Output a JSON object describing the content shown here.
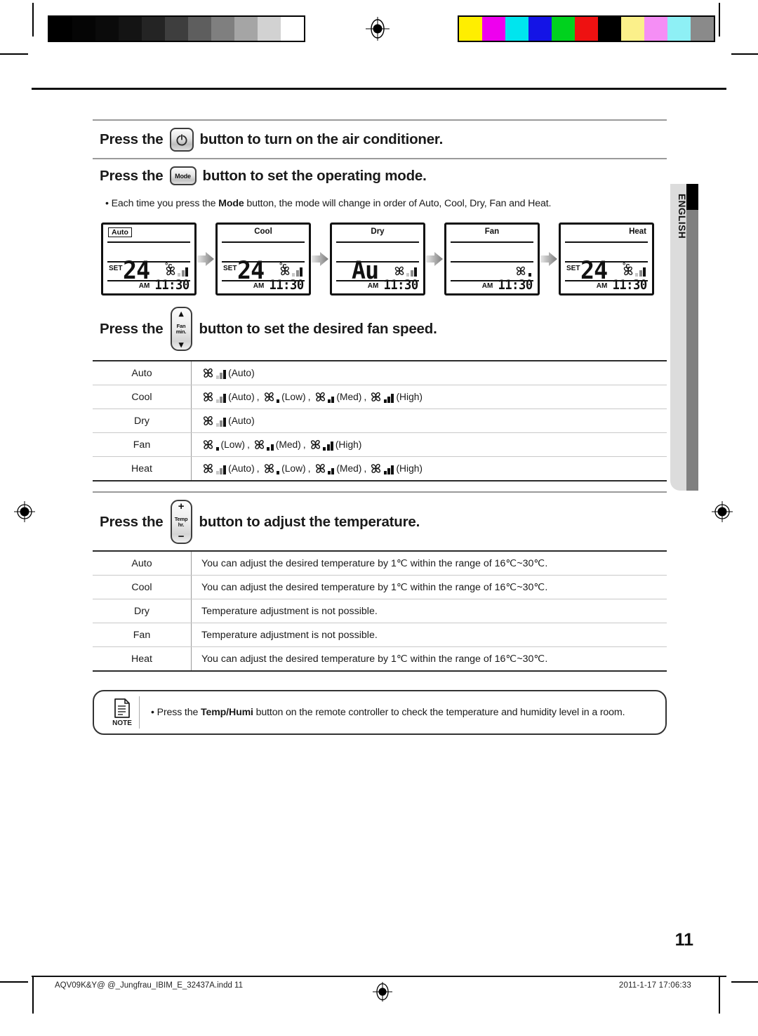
{
  "calibration": {
    "gray_ramp": [
      "#000000",
      "#050505",
      "#0b0b0b",
      "#141414",
      "#242424",
      "#3e3e3e",
      "#5e5e5e",
      "#7f7f7f",
      "#a5a5a5",
      "#d2d2d2",
      "#ffffff"
    ],
    "color_bars": [
      "#ffee00",
      "#ee00ee",
      "#00e5ee",
      "#1414e6",
      "#00d21e",
      "#ee1111",
      "#000000",
      "#fbf08a",
      "#f58ef5",
      "#8ef0f5",
      "#8a8a8a"
    ]
  },
  "sections": {
    "power": {
      "prefix": "Press the",
      "button_icon": "power-icon",
      "suffix": "button to turn on the air conditioner."
    },
    "mode": {
      "prefix": "Press the",
      "button_label": "Mode",
      "suffix": "button to set the operating mode.",
      "bullet_pre": "Each time you press the ",
      "bullet_bold": "Mode",
      "bullet_post": " button, the mode will change in order of Auto, Cool, Dry, Fan and Heat."
    },
    "fan": {
      "prefix": "Press the",
      "button_top": "Fan",
      "button_bottom": "min.",
      "suffix": "button to set the desired fan speed."
    },
    "temp": {
      "prefix": "Press the",
      "button_plus": "+",
      "button_top": "Temp",
      "button_bottom": "hr.",
      "button_minus": "−",
      "suffix": "button to adjust the temperature."
    }
  },
  "lcd_panels": [
    {
      "mode": "Auto",
      "label_style": "boxed",
      "set": "SET",
      "temp": "24",
      "unit": "°c",
      "fan": "auto",
      "am": "AM",
      "time": "11:30",
      "show_temp": true
    },
    {
      "mode": "Cool",
      "label_style": "center",
      "set": "SET",
      "temp": "24",
      "unit": "°c",
      "fan": "auto",
      "am": "AM",
      "time": "11:30",
      "show_temp": true
    },
    {
      "mode": "Dry",
      "label_style": "center",
      "set": "",
      "temp": "Au",
      "unit": "",
      "fan": "auto",
      "am": "AM",
      "time": "11:30",
      "show_temp": true
    },
    {
      "mode": "Fan",
      "label_style": "center",
      "set": "",
      "temp": "",
      "unit": "",
      "fan": "low",
      "am": "AM",
      "time": "11:30",
      "show_temp": false
    },
    {
      "mode": "Heat",
      "label_style": "right",
      "set": "SET",
      "temp": "24",
      "unit": "°c",
      "fan": "auto",
      "am": "AM",
      "time": "11:30",
      "show_temp": true
    }
  ],
  "fan_table": {
    "rows": [
      {
        "mode": "Auto",
        "speeds": [
          {
            "icon": "auto",
            "label": "(Auto)"
          }
        ]
      },
      {
        "mode": "Cool",
        "speeds": [
          {
            "icon": "auto",
            "label": "(Auto)"
          },
          {
            "icon": "low",
            "label": "(Low)"
          },
          {
            "icon": "med",
            "label": "(Med)"
          },
          {
            "icon": "high",
            "label": "(High)"
          }
        ]
      },
      {
        "mode": "Dry",
        "speeds": [
          {
            "icon": "auto",
            "label": "(Auto)"
          }
        ]
      },
      {
        "mode": "Fan",
        "speeds": [
          {
            "icon": "low",
            "label": "(Low)"
          },
          {
            "icon": "med",
            "label": "(Med)"
          },
          {
            "icon": "high",
            "label": "(High)"
          }
        ]
      },
      {
        "mode": "Heat",
        "speeds": [
          {
            "icon": "auto",
            "label": "(Auto)"
          },
          {
            "icon": "low",
            "label": "(Low)"
          },
          {
            "icon": "med",
            "label": "(Med)"
          },
          {
            "icon": "high",
            "label": "(High)"
          }
        ]
      }
    ]
  },
  "temp_table": {
    "rows": [
      {
        "mode": "Auto",
        "text": "You can adjust the desired temperature by 1℃ within the range of 16℃~30℃."
      },
      {
        "mode": "Cool",
        "text": "You can adjust the desired temperature by 1℃ within the range of 16℃~30℃."
      },
      {
        "mode": "Dry",
        "text": "Temperature adjustment is not possible."
      },
      {
        "mode": "Fan",
        "text": "Temperature adjustment is not possible."
      },
      {
        "mode": "Heat",
        "text": "You can adjust the desired temperature by 1℃ within the range of 16℃~30℃."
      }
    ]
  },
  "note": {
    "icon": "document-icon",
    "label": "NOTE",
    "bullet": "•",
    "text_pre": "Press the ",
    "text_bold": "Temp/Humi",
    "text_post": " button on the remote controller to check the temperature and humidity level in a room."
  },
  "side_tab": {
    "label": "ENGLISH"
  },
  "page_number": "11",
  "footer": {
    "file": "AQV09K&Y@ @_Jungfrau_IBIM_E_32437A.indd   11",
    "timestamp": "2011-1-17   17:06:33"
  }
}
